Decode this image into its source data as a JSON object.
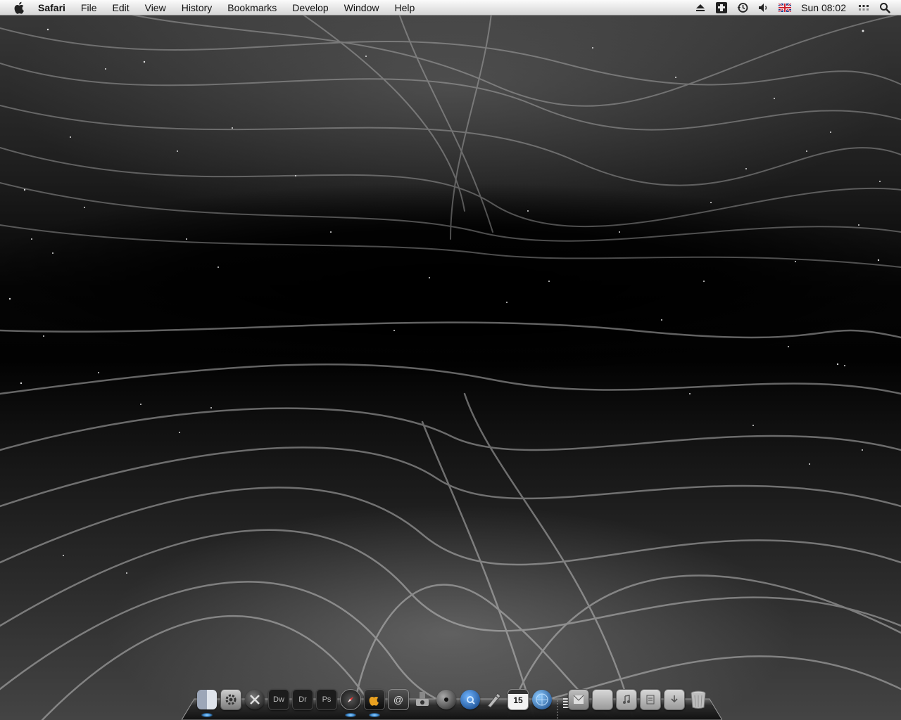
{
  "menubar": {
    "apple_icon": "apple-logo-icon",
    "app_name": "Safari",
    "menus": [
      "File",
      "Edit",
      "View",
      "History",
      "Bookmarks",
      "Develop",
      "Window",
      "Help"
    ],
    "extras": [
      "eject-icon",
      "inspector-icon",
      "time-machine-icon",
      "volume-icon",
      "uk-flag-input-icon",
      "spaces-icon",
      "spotlight-icon"
    ],
    "clock": "Sun 08:02"
  },
  "dock": {
    "items": [
      {
        "name": "finder",
        "icon": "finder-icon",
        "label": "",
        "running": true
      },
      {
        "name": "system-preferences",
        "icon": "system-preferences-icon",
        "label": "",
        "running": false
      },
      {
        "name": "mac-os-x",
        "icon": "mac-os-x-icon",
        "label": "",
        "running": false
      },
      {
        "name": "dreamweaver",
        "icon": "dreamweaver-icon",
        "label": "Dw",
        "running": false
      },
      {
        "name": "dreamweaver-2",
        "icon": "dreamweaver-icon",
        "label": "Dr",
        "running": false
      },
      {
        "name": "photoshop",
        "icon": "photoshop-icon",
        "label": "Ps",
        "running": false
      },
      {
        "name": "safari",
        "icon": "safari-compass-icon",
        "label": "",
        "running": true
      },
      {
        "name": "apple-store",
        "icon": "apple-store-icon",
        "label": "",
        "running": true
      },
      {
        "name": "address-book",
        "icon": "address-book-icon",
        "label": "@",
        "running": false
      },
      {
        "name": "utility",
        "icon": "dashboard-icon",
        "label": "",
        "running": false
      },
      {
        "name": "itunes",
        "icon": "itunes-icon",
        "label": "",
        "running": false
      },
      {
        "name": "quicktime",
        "icon": "quicktime-icon",
        "label": "",
        "running": false
      },
      {
        "name": "pen-tool",
        "icon": "pen-tool-icon",
        "label": "",
        "running": false
      },
      {
        "name": "ical",
        "icon": "calendar-icon",
        "label": "15",
        "running": false
      },
      {
        "name": "network",
        "icon": "globe-icon",
        "label": "",
        "running": false
      }
    ],
    "stacks": [
      {
        "name": "mail-stack",
        "icon": "mail-folder-icon"
      },
      {
        "name": "applications-folder",
        "icon": "applications-folder-icon"
      },
      {
        "name": "music-folder",
        "icon": "music-folder-icon"
      },
      {
        "name": "documents-folder",
        "icon": "documents-folder-icon"
      },
      {
        "name": "downloads-folder",
        "icon": "downloads-folder-icon"
      }
    ],
    "trash": "trash-icon"
  }
}
